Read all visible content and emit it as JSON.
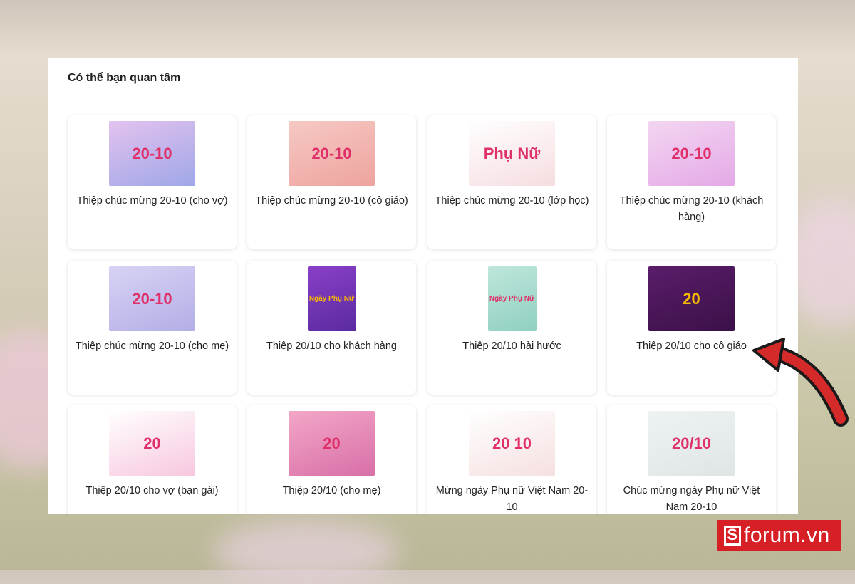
{
  "section_title": "Có thể bạn quan tâm",
  "cards": [
    {
      "label": "Thiệp chúc mừng 20-10 (cho vợ)",
      "thumb_text": "20-10",
      "colors": [
        "#e3c2ee",
        "#9fa7e8"
      ]
    },
    {
      "label": "Thiệp chúc mừng 20-10 (cô giáo)",
      "thumb_text": "20-10",
      "colors": [
        "#f6c9c4",
        "#eea39e"
      ]
    },
    {
      "label": "Thiệp chúc mừng 20-10 (lớp học)",
      "thumb_text": "Phụ Nữ",
      "colors": [
        "#ffffff",
        "#f6dde0"
      ]
    },
    {
      "label": "Thiệp chúc mừng 20-10 (khách hàng)",
      "thumb_text": "20-10",
      "colors": [
        "#f3d6f2",
        "#e4a9e6"
      ]
    },
    {
      "label": "Thiệp chúc mừng 20-10 (cho mẹ)",
      "thumb_text": "20-10",
      "colors": [
        "#d7d3f4",
        "#b3aee6"
      ]
    },
    {
      "label": "Thiệp 20/10 cho khách hàng",
      "thumb_text": "Ngày Phụ Nữ",
      "colors": [
        "#8a3fc7",
        "#5a2ba0"
      ],
      "tall": true
    },
    {
      "label": "Thiệp 20/10 hài hước",
      "thumb_text": "Ngày Phụ Nữ",
      "colors": [
        "#bfe6dc",
        "#8fd0c1"
      ],
      "tall": true
    },
    {
      "label": "Thiệp 20/10 cho cô giáo",
      "thumb_text": "20",
      "colors": [
        "#5a1d6a",
        "#3b1048"
      ]
    },
    {
      "label": "Thiệp 20/10 cho vợ (bạn gái)",
      "thumb_text": "20",
      "colors": [
        "#ffffff",
        "#f7c7df"
      ]
    },
    {
      "label": "Thiệp 20/10 (cho mẹ)",
      "thumb_text": "20",
      "colors": [
        "#f3a7c7",
        "#d86fa8"
      ]
    },
    {
      "label": "Mừng ngày Phụ nữ Việt Nam 20-10",
      "thumb_text": "20 10",
      "colors": [
        "#ffffff",
        "#f6e0e0"
      ]
    },
    {
      "label": "Chúc mừng ngày Phụ nữ Việt Nam 20-10",
      "thumb_text": "20/10",
      "colors": [
        "#eef2f2",
        "#dfe5e5"
      ]
    }
  ],
  "watermark": {
    "text": "forum.vn",
    "mark": "S"
  },
  "accent": "#d71f26"
}
